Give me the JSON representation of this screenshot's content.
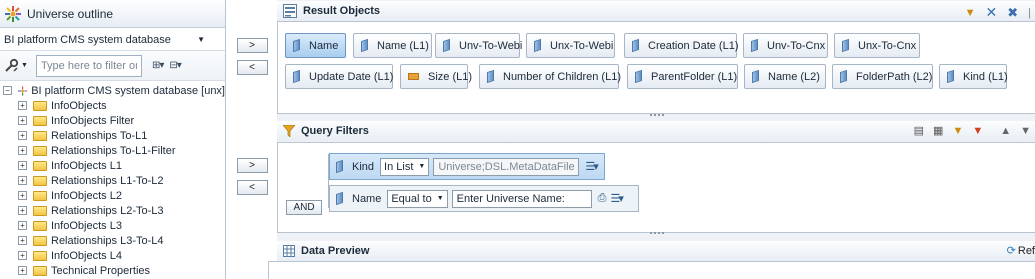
{
  "left": {
    "title": "Universe outline",
    "datasource": "BI platform CMS system database",
    "filter_placeholder": "Type here to filter on th",
    "root": "BI platform CMS system database [unx]",
    "folders": [
      "InfoObjects",
      "InfoObjects Filter",
      "Relationships To-L1",
      "Relationships To-L1-Filter",
      "InfoObjects L1",
      "Relationships L1-To-L2",
      "InfoObjects L2",
      "Relationships L2-To-L3",
      "InfoObjects L3",
      "Relationships L3-To-L4",
      "InfoObjects L4",
      "Technical Properties"
    ]
  },
  "move": {
    "add": ">",
    "remove": "<"
  },
  "result_objects": {
    "title": "Result Objects",
    "items": [
      {
        "label": "Name",
        "kind": "dimension",
        "selected": true
      },
      {
        "label": "Name (L1)",
        "kind": "dimension"
      },
      {
        "label": "Unv-To-Webi",
        "kind": "dimension"
      },
      {
        "label": "Unx-To-Webi",
        "kind": "dimension"
      },
      {
        "label": "Creation Date (L1)",
        "kind": "dimension"
      },
      {
        "label": "Unv-To-Cnx",
        "kind": "dimension"
      },
      {
        "label": "Unx-To-Cnx",
        "kind": "dimension"
      },
      {
        "label": "Update Date (L1)",
        "kind": "dimension"
      },
      {
        "label": "Size (L1)",
        "kind": "measure"
      },
      {
        "label": "Number of Children (L1)",
        "kind": "dimension"
      },
      {
        "label": "ParentFolder (L1)",
        "kind": "dimension"
      },
      {
        "label": "Name (L2)",
        "kind": "dimension"
      },
      {
        "label": "FolderPath (L2)",
        "kind": "dimension"
      },
      {
        "label": "Kind (L1)",
        "kind": "dimension"
      }
    ]
  },
  "query_filters": {
    "title": "Query Filters",
    "operator": "AND",
    "filters": [
      {
        "object": "Kind",
        "op": "In List",
        "value": "Universe;DSL.MetaDataFile"
      },
      {
        "object": "Name",
        "op": "Equal to",
        "value": "Enter Universe Name:"
      }
    ]
  },
  "data_preview": {
    "title": "Data Preview",
    "refresh": "Ref"
  }
}
